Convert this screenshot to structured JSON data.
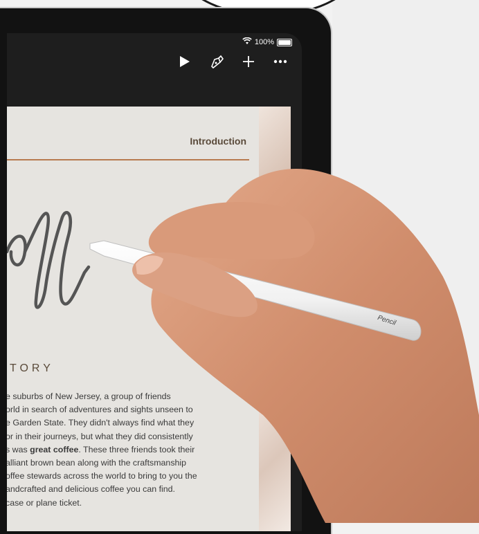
{
  "status_bar": {
    "wifi_icon": "wifi-icon",
    "battery_text": "100%",
    "battery_icon": "battery-icon"
  },
  "toolbar": {
    "items": [
      {
        "icon": "play-icon"
      },
      {
        "icon": "pen-nib-icon"
      },
      {
        "icon": "plus-icon"
      },
      {
        "icon": "more-icon"
      }
    ]
  },
  "document": {
    "section_label": "Introduction",
    "heading_partial": "TORY",
    "paragraph_lines": [
      "e suburbs of New Jersey, a group of friends",
      "orld in search of adventures and sights unseen to",
      "e Garden State. They didn't always find what they",
      "or in their journeys, but what they did consistently",
      "s was ",
      "alliant brown bean along with the craftsmanship",
      "offee stewards across the world to bring to you the",
      "andcrafted and delicious coffee you can find.",
      "case or plane ticket."
    ],
    "bold_phrase": "great coffee",
    "after_bold": ". These three friends took their"
  },
  "pencil": {
    "brand_text": "Pencil"
  },
  "colors": {
    "accent_rule": "#b77a4f",
    "page_bg": "#e6e4e0",
    "device": "#121212"
  }
}
